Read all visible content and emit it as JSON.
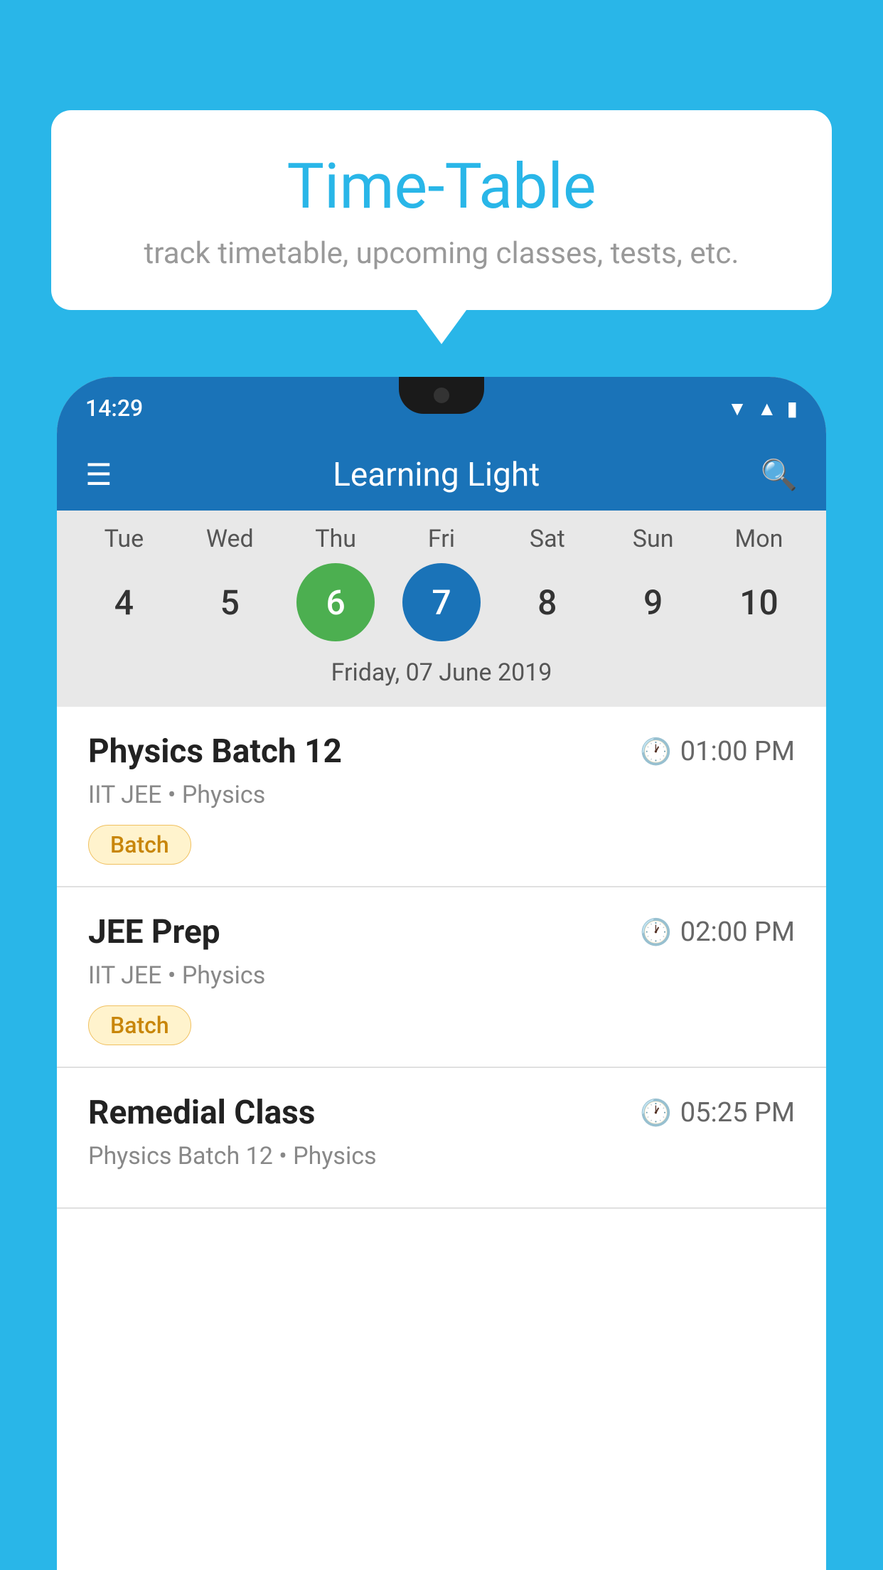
{
  "background_color": "#29B6E8",
  "speech_bubble": {
    "title": "Time-Table",
    "subtitle": "track timetable, upcoming classes, tests, etc."
  },
  "phone": {
    "status_bar": {
      "time": "14:29"
    },
    "app_header": {
      "title": "Learning Light",
      "hamburger_label": "≡",
      "search_label": "🔍"
    },
    "calendar": {
      "days": [
        "Tue",
        "Wed",
        "Thu",
        "Fri",
        "Sat",
        "Sun",
        "Mon"
      ],
      "dates": [
        4,
        5,
        6,
        7,
        8,
        9,
        10
      ],
      "today_index": 2,
      "selected_index": 3,
      "selected_date_label": "Friday, 07 June 2019"
    },
    "schedule": [
      {
        "title": "Physics Batch 12",
        "time": "01:00 PM",
        "meta": "IIT JEE • Physics",
        "badge": "Batch"
      },
      {
        "title": "JEE Prep",
        "time": "02:00 PM",
        "meta": "IIT JEE • Physics",
        "badge": "Batch"
      },
      {
        "title": "Remedial Class",
        "time": "05:25 PM",
        "meta": "Physics Batch 12 • Physics",
        "badge": ""
      }
    ]
  }
}
